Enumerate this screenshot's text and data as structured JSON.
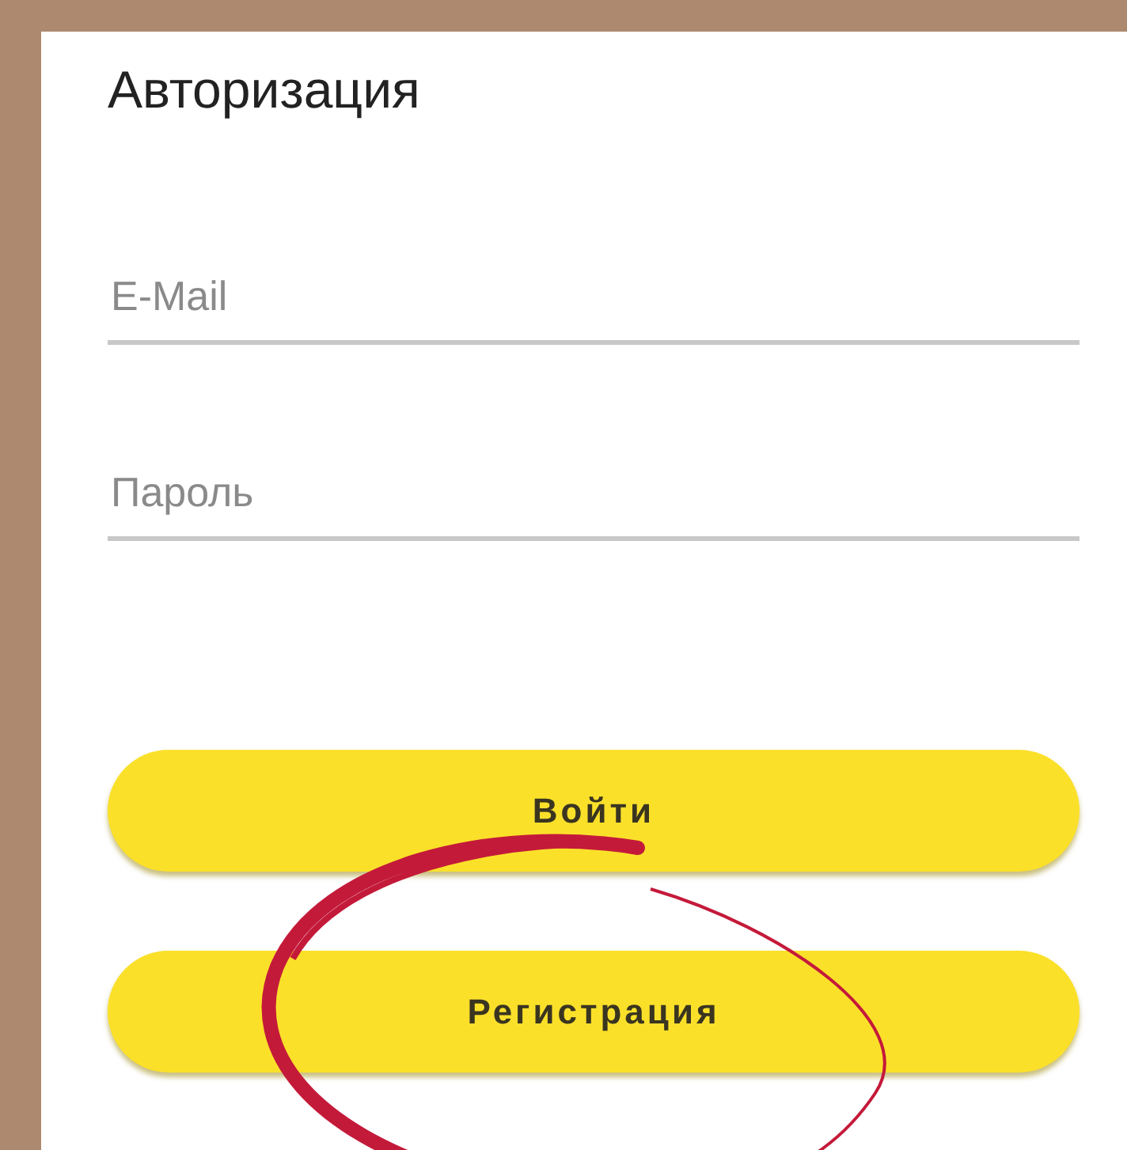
{
  "title": "Авторизация",
  "fields": [
    {
      "placeholder": "E-Mail"
    },
    {
      "placeholder": "Пароль"
    }
  ],
  "buttons": [
    {
      "label": "Войти",
      "circled": false
    },
    {
      "label": "Регистрация",
      "circled": true
    }
  ]
}
